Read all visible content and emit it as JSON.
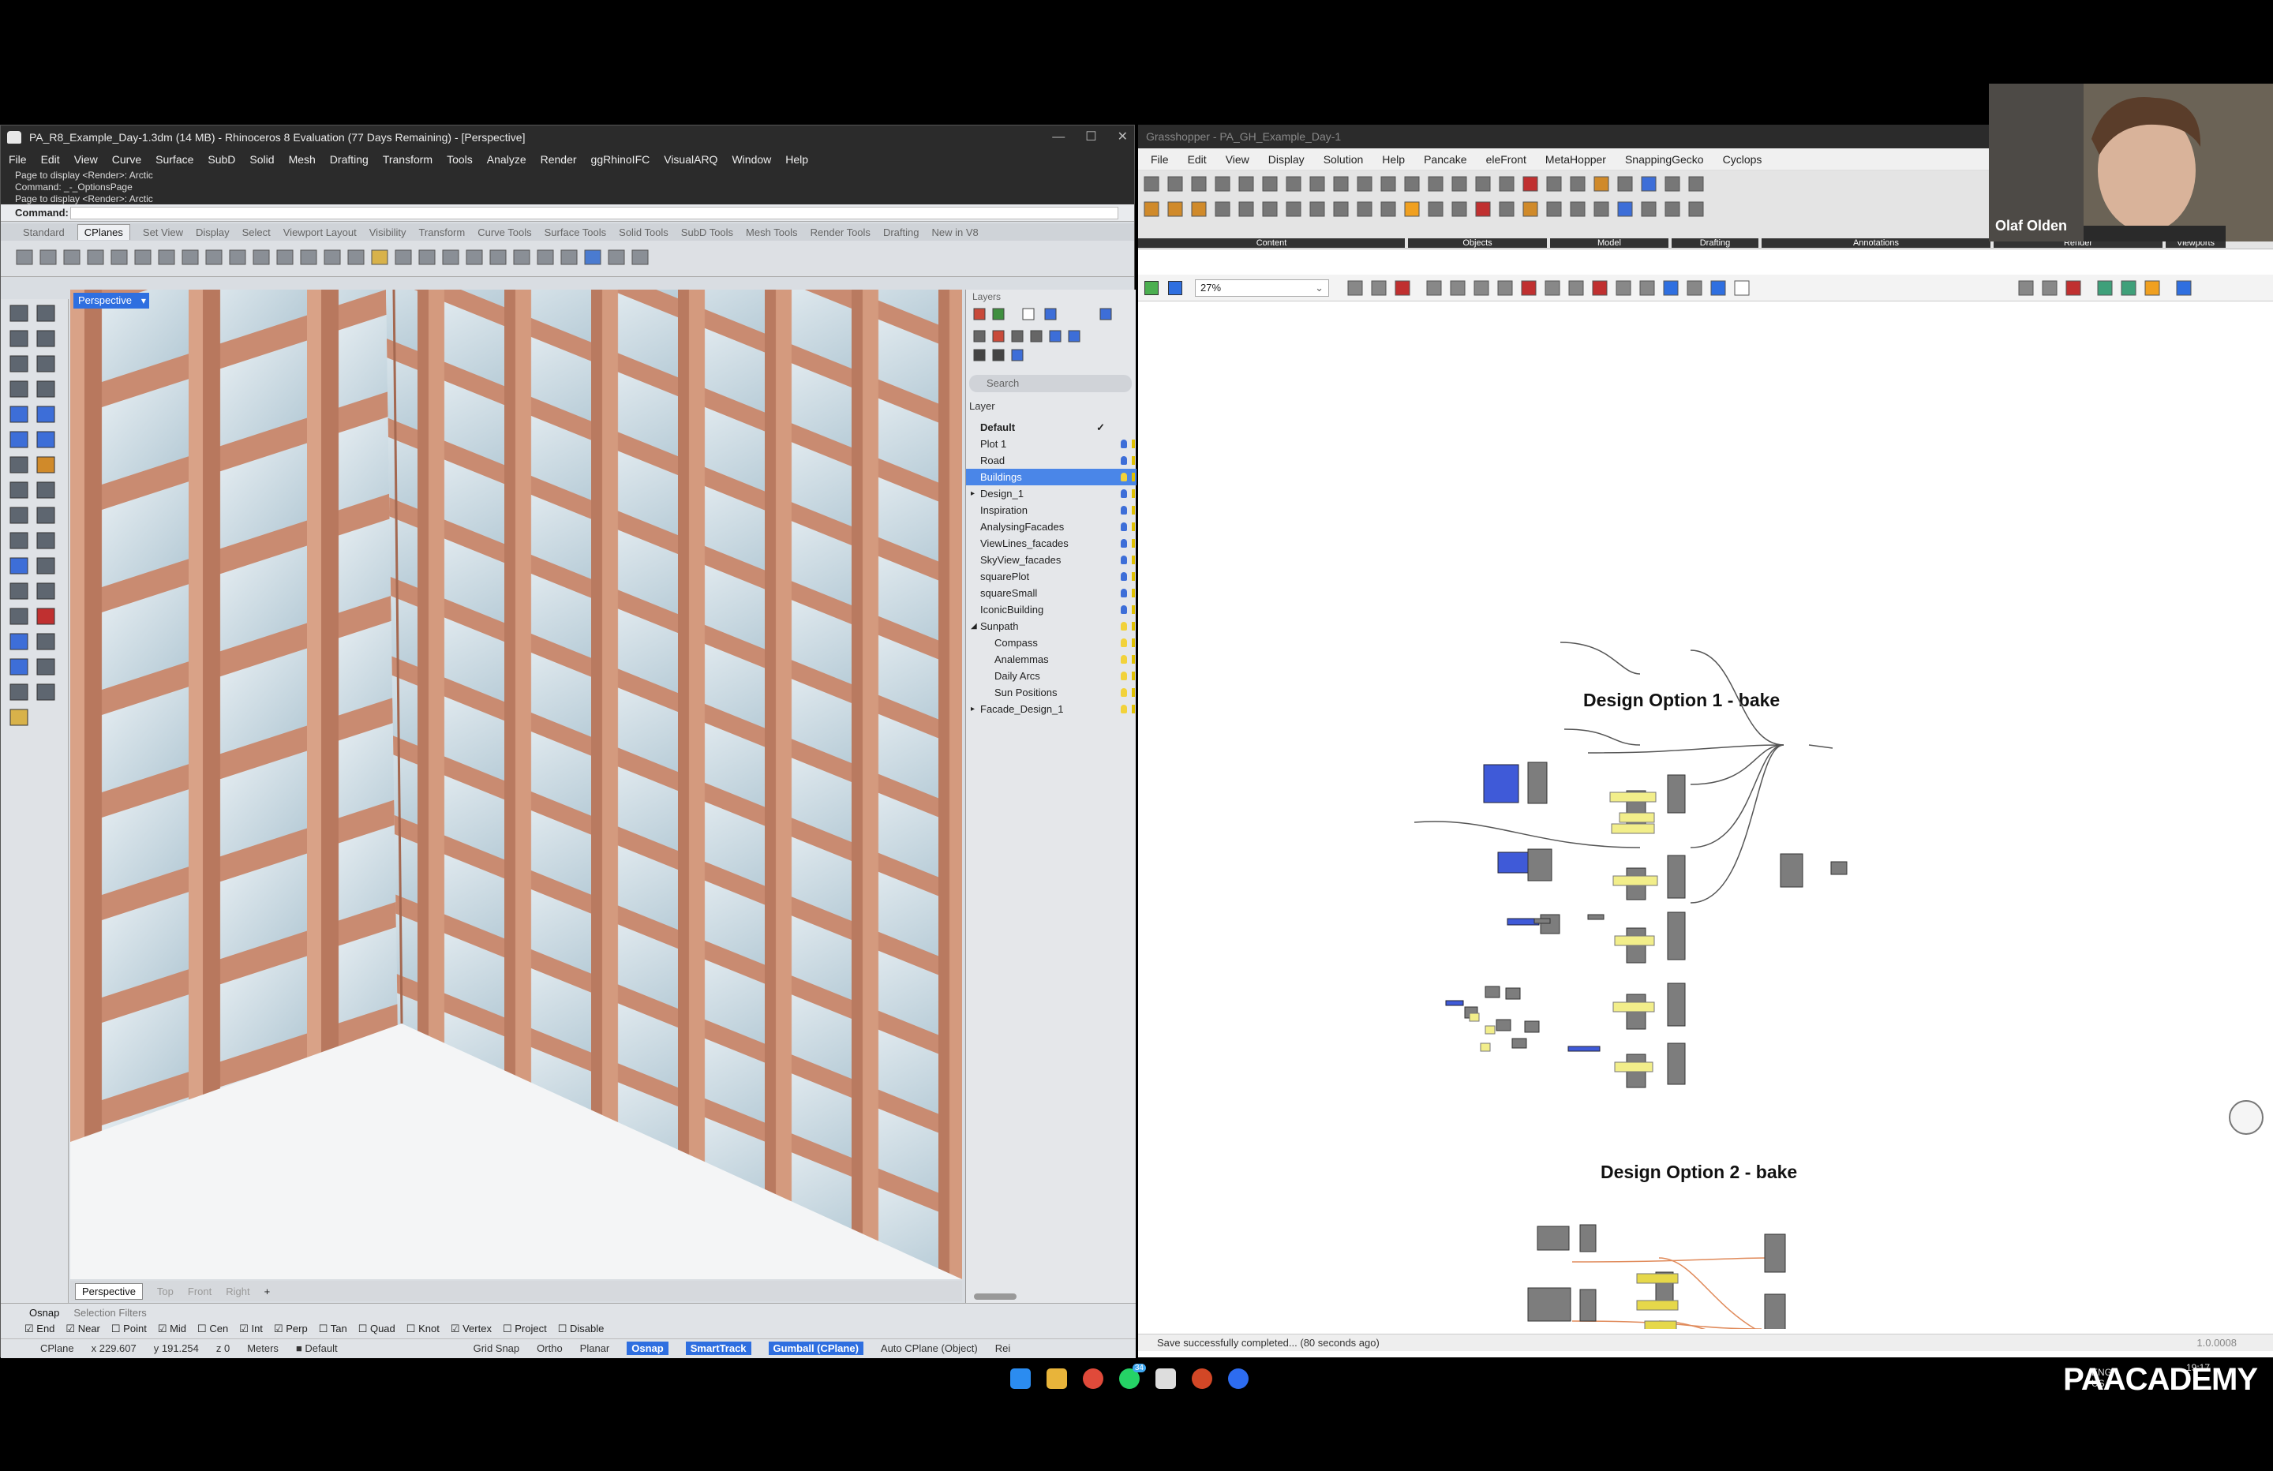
{
  "rhino": {
    "title": "PA_R8_Example_Day-1.3dm (14 MB) - Rhinoceros 8 Evaluation (77 Days Remaining) - [Perspective]",
    "menu": [
      "File",
      "Edit",
      "View",
      "Curve",
      "Surface",
      "SubD",
      "Solid",
      "Mesh",
      "Drafting",
      "Transform",
      "Tools",
      "Analyze",
      "Render",
      "ggRhinoIFC",
      "VisualARQ",
      "Window",
      "Help"
    ],
    "history": [
      "Page to display <Render>: Arctic",
      "Command: _-_OptionsPage",
      "Page to display <Render>: Arctic"
    ],
    "command_label": "Command:",
    "tabs": [
      "Standard",
      "CPlanes",
      "Set View",
      "Display",
      "Select",
      "Viewport Layout",
      "Visibility",
      "Transform",
      "Curve Tools",
      "Surface Tools",
      "Solid Tools",
      "SubD Tools",
      "Mesh Tools",
      "Render Tools",
      "Drafting",
      "New in V8"
    ],
    "viewport_label": "Perspective",
    "viewport_tabs": [
      "Perspective",
      "Top",
      "Front",
      "Right",
      "+"
    ],
    "layers": {
      "panel_title": "Layers",
      "search_placeholder": "Search",
      "header": "Layer",
      "items": [
        "Default",
        "Plot 1",
        "Road",
        "Buildings",
        "Design_1",
        "Inspiration",
        "AnalysingFacades",
        "ViewLines_facades",
        "SkyView_facades",
        "squarePlot",
        "squareSmall",
        "IconicBuilding",
        "Sunpath",
        "Compass",
        "Analemmas",
        "Daily Arcs",
        "Sun Positions",
        "Facade_Design_1"
      ]
    },
    "osnap_tabs": [
      "Osnap",
      "Selection Filters"
    ],
    "osnaps": [
      "End",
      "Near",
      "Point",
      "Mid",
      "Cen",
      "Int",
      "Perp",
      "Tan",
      "Quad",
      "Knot",
      "Vertex",
      "Project",
      "Disable"
    ],
    "status": {
      "cplane": "CPlane",
      "x": "x 229.607",
      "y": "y 191.254",
      "z": "z 0",
      "units": "Meters",
      "layer": "Default",
      "toggles": [
        "Grid Snap",
        "Ortho",
        "Planar",
        "Osnap",
        "SmartTrack",
        "Gumball (CPlane)",
        "Auto CPlane (Object)",
        "Rei"
      ]
    }
  },
  "grasshopper": {
    "title": "Grasshopper - PA_GH_Example_Day-1",
    "menu": [
      "File",
      "Edit",
      "View",
      "Display",
      "Solution",
      "Help",
      "Pancake",
      "eleFront",
      "MetaHopper",
      "SnappingGecko",
      "Cyclops"
    ],
    "ribbon_groups": [
      "Content",
      "Objects",
      "Model",
      "Drafting",
      "Annotations",
      "Render",
      "Viewports"
    ],
    "zoom": "27%",
    "sections": [
      "Design Option 1 - bake",
      "Design Option 2 - bake"
    ],
    "status": "Save successfully completed... (80 seconds ago)",
    "version": "1.0.0008"
  },
  "webcam": {
    "name": "Olaf Olden"
  },
  "taskbar": {
    "lang": "ENG",
    "lang2": "US",
    "time": "19:17",
    "brand": "PAACADEMY",
    "badge": "34"
  },
  "colors": {
    "facade": "#c98b71",
    "selected": "#4a86e8",
    "gh_blue": "#3f5ad8",
    "gh_yellow": "#f2ee8a"
  }
}
